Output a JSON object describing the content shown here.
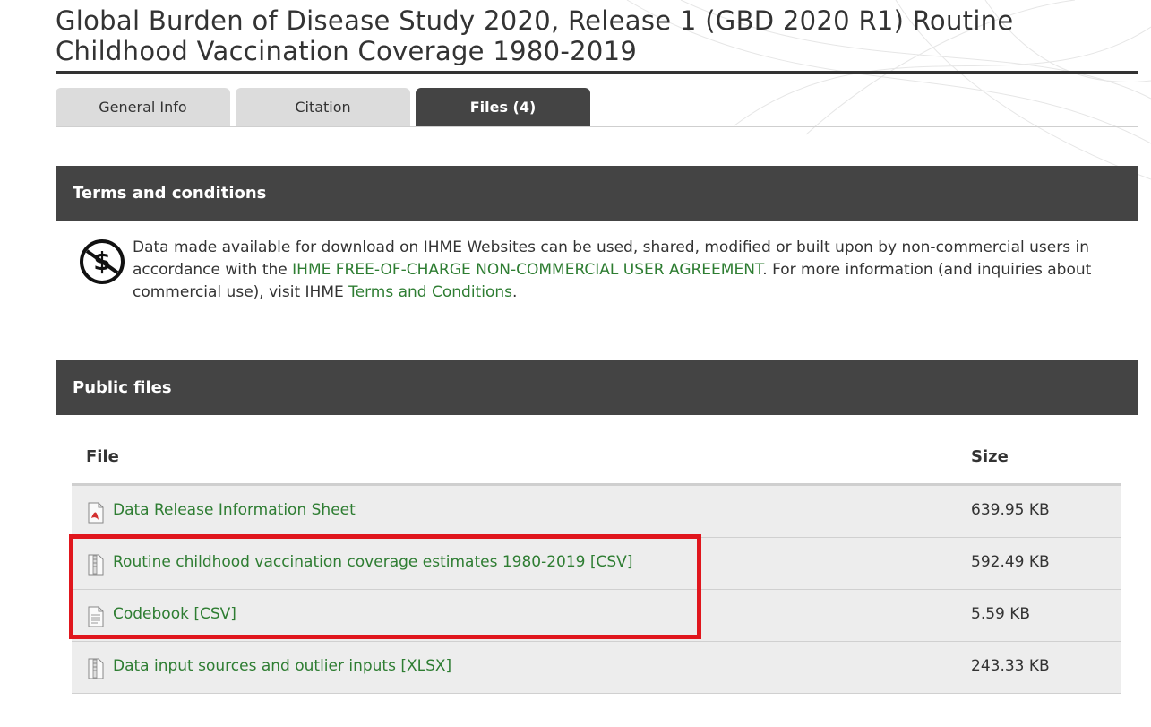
{
  "page": {
    "title": "Global Burden of Disease Study 2020, Release 1 (GBD 2020 R1) Routine Childhood Vaccination Coverage 1980-2019"
  },
  "tabs": [
    {
      "label": "General Info",
      "active": false
    },
    {
      "label": "Citation",
      "active": false
    },
    {
      "label": "Files (4)",
      "active": true
    }
  ],
  "terms": {
    "heading": "Terms and conditions",
    "text_1": "Data made available for download on IHME Websites can be used, shared, modified or built upon by non-commercial users in accordance with the ",
    "link_agreement": "IHME FREE-OF-CHARGE NON-COMMERCIAL USER AGREEMENT",
    "text_2": ". For more information (and inquiries about commercial use), visit IHME ",
    "link_terms": "Terms and Conditions",
    "text_3": ".",
    "icon": "no-commercial-icon"
  },
  "public_files": {
    "heading": "Public files",
    "columns": {
      "file": "File",
      "size": "Size"
    },
    "rows": [
      {
        "name": "Data Release Information Sheet",
        "size": "639.95 KB",
        "icon": "pdf-file-icon"
      },
      {
        "name": "Routine childhood vaccination coverage estimates 1980-2019 [CSV]",
        "size": "592.49 KB",
        "icon": "zip-file-icon"
      },
      {
        "name": "Codebook [CSV]",
        "size": "5.59 KB",
        "icon": "text-file-icon"
      },
      {
        "name": "Data input sources and outlier inputs [XLSX]",
        "size": "243.33 KB",
        "icon": "zip-file-icon"
      }
    ]
  },
  "colors": {
    "link": "#2e7d32",
    "bar": "#444444",
    "highlight": "#e0161d"
  }
}
